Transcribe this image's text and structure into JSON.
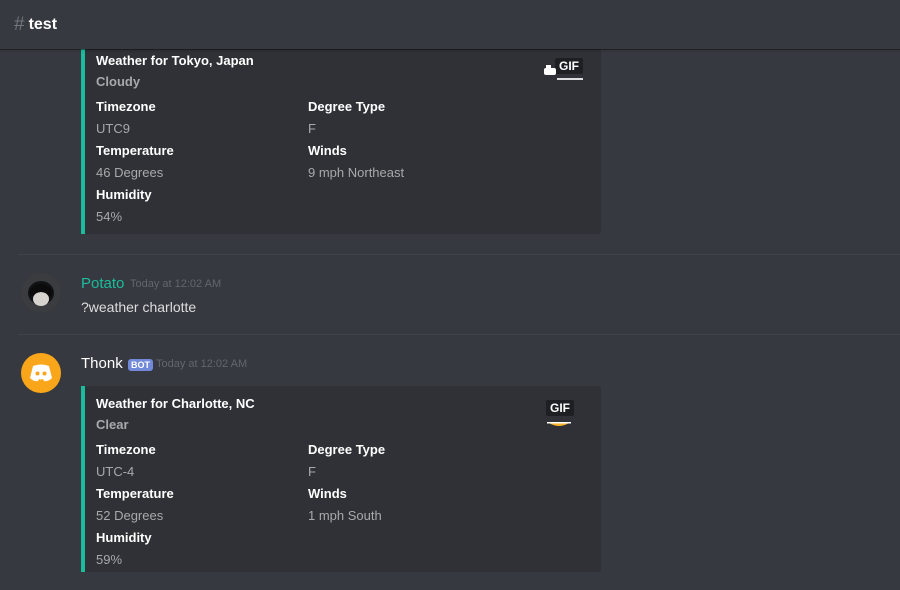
{
  "channel": {
    "name": "test"
  },
  "embed1": {
    "title": "Weather for Tokyo, Japan",
    "description": "Cloudy",
    "fields": {
      "timezone": {
        "name": "Timezone",
        "value": "UTC9"
      },
      "degree": {
        "name": "Degree Type",
        "value": "F"
      },
      "temperature": {
        "name": "Temperature",
        "value": "46 Degrees"
      },
      "winds": {
        "name": "Winds",
        "value": "9 mph Northeast"
      },
      "humidity": {
        "name": "Humidity",
        "value": "54%"
      }
    },
    "thumbnail_label": "GIF"
  },
  "message_user": {
    "author": "Potato",
    "author_color": "#1abc9c",
    "timestamp": "Today at 12:02 AM",
    "content": "?weather charlotte"
  },
  "message_bot": {
    "author": "Thonk",
    "bot_tag": "BOT",
    "timestamp": "Today at 12:02 AM"
  },
  "embed2": {
    "title": "Weather for Charlotte, NC",
    "description": "Clear",
    "fields": {
      "timezone": {
        "name": "Timezone",
        "value": "UTC-4"
      },
      "degree": {
        "name": "Degree Type",
        "value": "F"
      },
      "temperature": {
        "name": "Temperature",
        "value": "52 Degrees"
      },
      "winds": {
        "name": "Winds",
        "value": "1 mph South"
      },
      "humidity": {
        "name": "Humidity",
        "value": "59%"
      }
    },
    "thumbnail_label": "GIF"
  },
  "colors": {
    "embed_accent": "#1abc9c",
    "bot_avatar": "#faa61a",
    "bot_tag": "#7289da"
  }
}
